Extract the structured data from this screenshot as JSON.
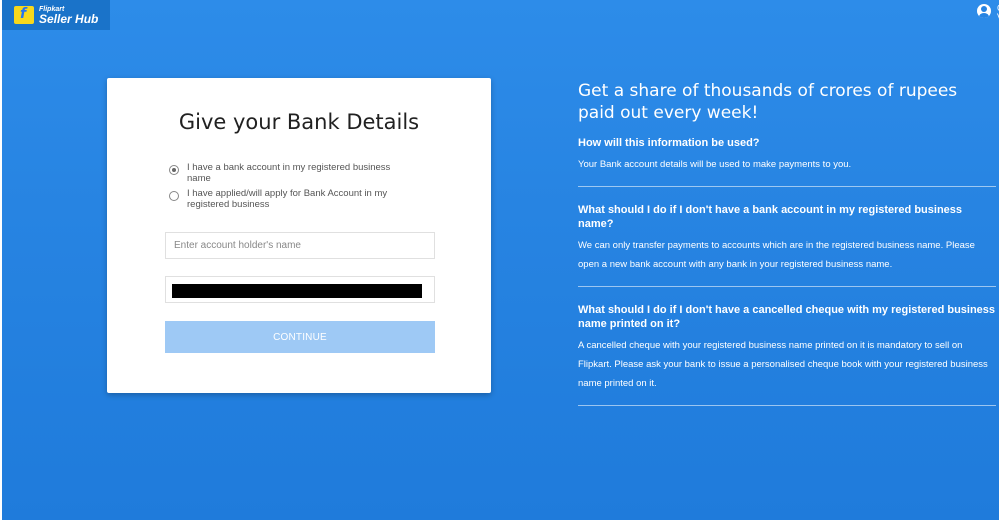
{
  "brand": {
    "small": "Flipkart",
    "big": "Seller Hub"
  },
  "user": {
    "icon": "user-circle-icon",
    "text": "C V"
  },
  "form": {
    "title": "Give your Bank Details",
    "radio_options": [
      {
        "label": "I have a bank account in my registered business name",
        "checked": true
      },
      {
        "label": "I have applied/will apply for Bank Account in my registered business",
        "checked": false
      }
    ],
    "account_holder_placeholder": "Enter account holder's name",
    "account_number_value": "",
    "continue_label": "CONTINUE"
  },
  "info": {
    "headline": "Get a share of thousands of crores of rupees paid out every week!",
    "faqs": [
      {
        "question": "How will this information be used?",
        "answer": "Your Bank account details will be used to make payments to you."
      },
      {
        "question": "What should I do if I don't have a bank account in my registered business name?",
        "answer": "We can only transfer payments to accounts which are in the registered business name. Please open a new bank account with any bank in your registered business name."
      },
      {
        "question": "What should I do if I don't have a cancelled cheque with my registered business name printed on it?",
        "answer": "A cancelled cheque with your registered business name printed on it is mandatory to sell on Flipkart. Please ask your bank to issue a personalised cheque book with your registered business name printed on it."
      }
    ]
  },
  "colors": {
    "background": "#2784e2",
    "button_disabled": "#9ec9f5",
    "logo_yellow": "#f8d81c"
  }
}
